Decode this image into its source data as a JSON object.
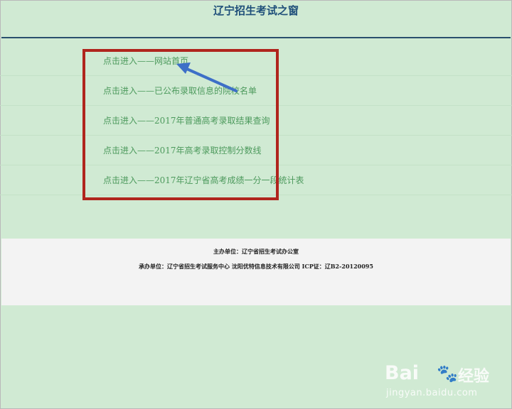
{
  "header": {
    "title": "辽宁招生考试之窗"
  },
  "links": [
    {
      "label": "点击进入——网站首页"
    },
    {
      "label": "点击进入——已公布录取信息的院校名单"
    },
    {
      "label": "点击进入——2017年普通高考录取结果查询"
    },
    {
      "label": "点击进入——2017年高考录取控制分数线"
    },
    {
      "label": "点击进入——2017年辽宁省高考成绩一分一段统计表"
    }
  ],
  "footer": {
    "host": "主办单位：辽宁省招生考试办公室",
    "operator": "承办单位：辽宁省招生考试服务中心 沈阳优特信息技术有限公司 ICP证：辽B2-20120095"
  },
  "watermark": {
    "brand": "Bai",
    "brand_suffix": "经验",
    "url": "jingyan.baidu.com"
  },
  "colors": {
    "background": "#d0ead3",
    "link": "#4d9a5d",
    "highlight": "#b0251d",
    "arrow": "#3d6fc7"
  }
}
